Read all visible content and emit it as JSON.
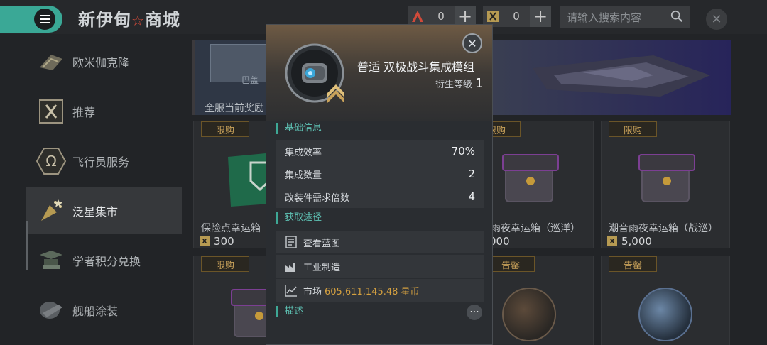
{
  "header": {
    "title": "新伊甸",
    "title_mark": "☆",
    "title_suffix": "商城",
    "currency": [
      {
        "icon": "alliance-currency-icon",
        "value": "0",
        "color": "#d04a3a"
      },
      {
        "icon": "x-currency-icon",
        "value": "0",
        "color": "#b69a52"
      }
    ],
    "search_placeholder": "请输入搜索内容"
  },
  "sidebar": {
    "items": [
      {
        "label": "欧米伽克隆",
        "icon": "omega-clone-icon"
      },
      {
        "label": "推荐",
        "icon": "x-badge-icon"
      },
      {
        "label": "飞行员服务",
        "icon": "omega-icon"
      },
      {
        "label": "泛星集市",
        "icon": "party-popper-icon",
        "active": true
      },
      {
        "label": "学者积分兑换",
        "icon": "scholar-icon"
      },
      {
        "label": "舰船涂装",
        "icon": "ship-paint-icon"
      }
    ]
  },
  "content": {
    "banner": {
      "sub": "巴盖",
      "caption": "全服当前奖励"
    },
    "cards": [
      {
        "tag": "限购",
        "name": "保险点幸运箱",
        "price": "300"
      },
      {
        "tag": "限购",
        "name": "雨夜幸运箱（巡洋）",
        "price": "000"
      },
      {
        "tag": "限购",
        "name": "潮音雨夜幸运箱（战巡）",
        "price": "5,000"
      },
      {
        "tag": "限购",
        "name": "",
        "price": ""
      },
      {
        "tag": "",
        "name": "",
        "price": ""
      },
      {
        "tag": "告罄",
        "name": "",
        "price": ""
      },
      {
        "tag": "告罄",
        "name": "",
        "price": ""
      }
    ]
  },
  "modal": {
    "title": "普适 双极战斗集成模组",
    "level_label": "衍生等级",
    "level_value": "1",
    "basic_title": "基础信息",
    "basic": [
      {
        "label": "集成效率",
        "value": "70%"
      },
      {
        "label": "集成数量",
        "value": "2"
      },
      {
        "label": "改装件需求倍数",
        "value": "4"
      }
    ],
    "source_title": "获取途径",
    "sources": [
      {
        "label": "查看蓝图",
        "icon": "blueprint-icon"
      },
      {
        "label": "工业制造",
        "icon": "factory-icon"
      },
      {
        "label": "市场",
        "icon": "market-chart-icon",
        "value": "605,611,145.48 星币"
      }
    ],
    "desc_title": "描述",
    "more": "···"
  }
}
